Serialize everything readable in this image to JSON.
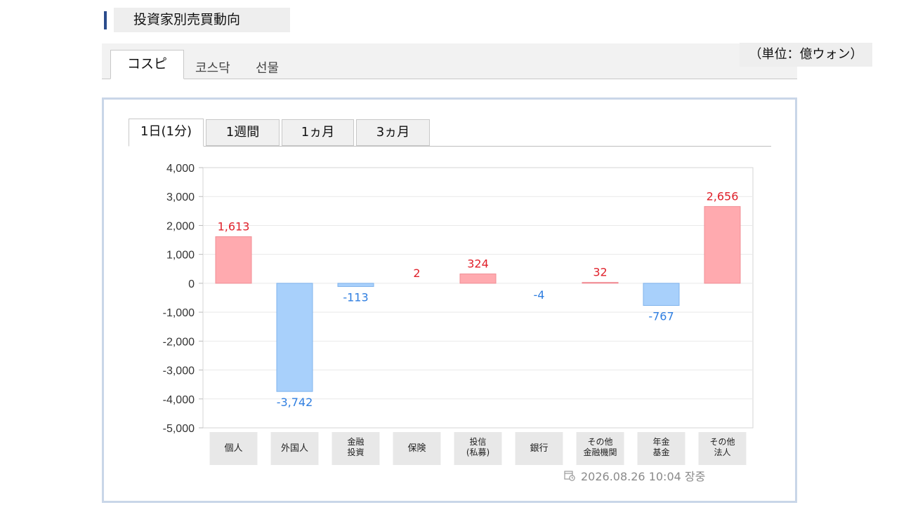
{
  "header": {
    "title": "投資家別売買動向"
  },
  "market_tabs": [
    {
      "label": "コスピ",
      "active": true
    },
    {
      "label": "코스닥",
      "active": false
    },
    {
      "label": "선물",
      "active": false
    }
  ],
  "unit_label": "（単位：億ウォン）",
  "period_tabs": [
    {
      "label": "1日(1分)",
      "active": true
    },
    {
      "label": "1週間",
      "active": false
    },
    {
      "label": "1ヵ月",
      "active": false
    },
    {
      "label": "3ヵ月",
      "active": false
    }
  ],
  "timestamp": "2026.08.26 10:04 장중",
  "colors": {
    "positive_fill": "#ffaaaf",
    "positive_text": "#e0212b",
    "negative_fill": "#a8d0fb",
    "negative_text": "#2f7ee0"
  },
  "chart_data": {
    "type": "bar",
    "categories": [
      [
        "個人"
      ],
      [
        "外国人"
      ],
      [
        "金融",
        "投資"
      ],
      [
        "保険"
      ],
      [
        "投信",
        "(私募)"
      ],
      [
        "銀行"
      ],
      [
        "その他",
        "金融機関"
      ],
      [
        "年金",
        "基金"
      ],
      [
        "その他",
        "法人"
      ]
    ],
    "values": [
      1613,
      -3742,
      -113,
      2,
      324,
      -4,
      32,
      -767,
      2656
    ],
    "value_labels": [
      "1,613",
      "-3,742",
      "-113",
      "2",
      "324",
      "-4",
      "32",
      "-767",
      "2,656"
    ],
    "yticks": [
      "4,000",
      "3,000",
      "2,000",
      "1,000",
      "0",
      "-1,000",
      "-2,000",
      "-3,000",
      "-4,000",
      "-5,000"
    ],
    "ylim": [
      -5000,
      4000
    ],
    "grid": true
  }
}
